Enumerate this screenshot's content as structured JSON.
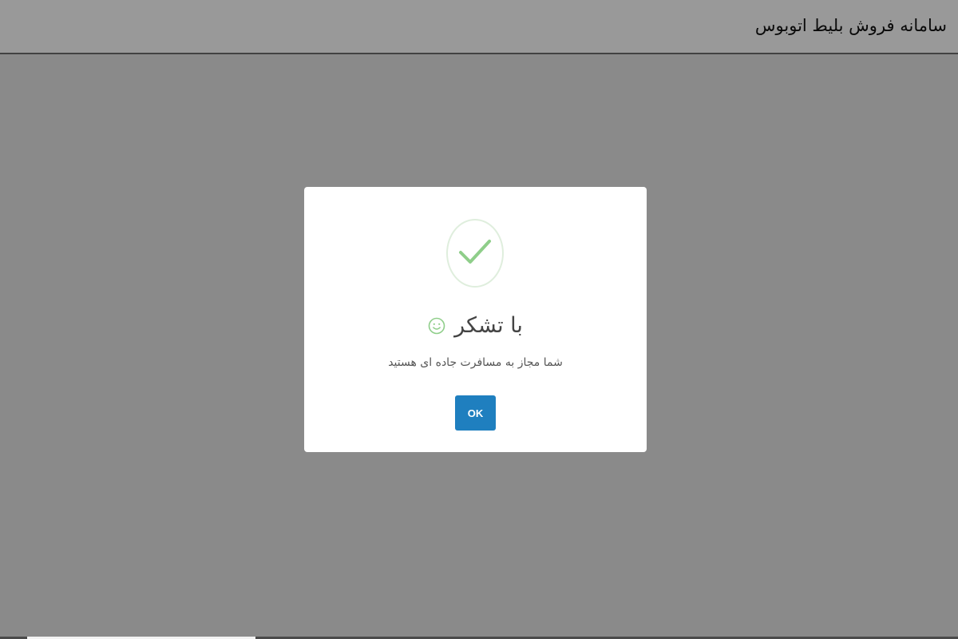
{
  "header": {
    "title": "سامانه فروش بلیط اتوبوس"
  },
  "modal": {
    "icon": "checkmark-icon",
    "title": "با تشکر",
    "title_icon": "smiley-icon",
    "message": "شما مجاز به مسافرت جاده ای هستید",
    "ok_label": "OK"
  },
  "colors": {
    "page_background": "#e6e6e6",
    "overlay": "rgba(0,0,0,0.4)",
    "modal_background": "#ffffff",
    "button_background": "#1f7fbf",
    "success_green": "#8fce8a",
    "text_dark": "#444444"
  }
}
